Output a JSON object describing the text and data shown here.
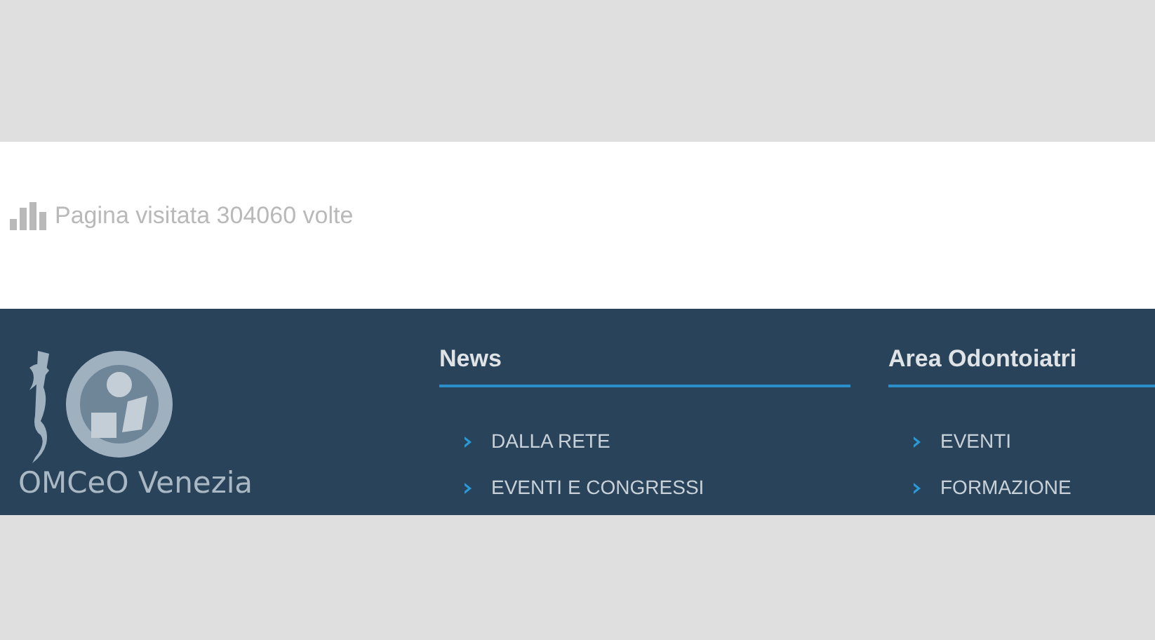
{
  "visit_counter": {
    "text": "Pagina visitata 304060 volte"
  },
  "footer": {
    "brand": "OMCeO Venezia",
    "columns": [
      {
        "title": "News",
        "links": [
          "DALLA RETE",
          "EVENTI E CONGRESSI"
        ]
      },
      {
        "title": "Area Odontoiatri",
        "links": [
          "EVENTI",
          "FORMAZIONE"
        ]
      }
    ]
  }
}
